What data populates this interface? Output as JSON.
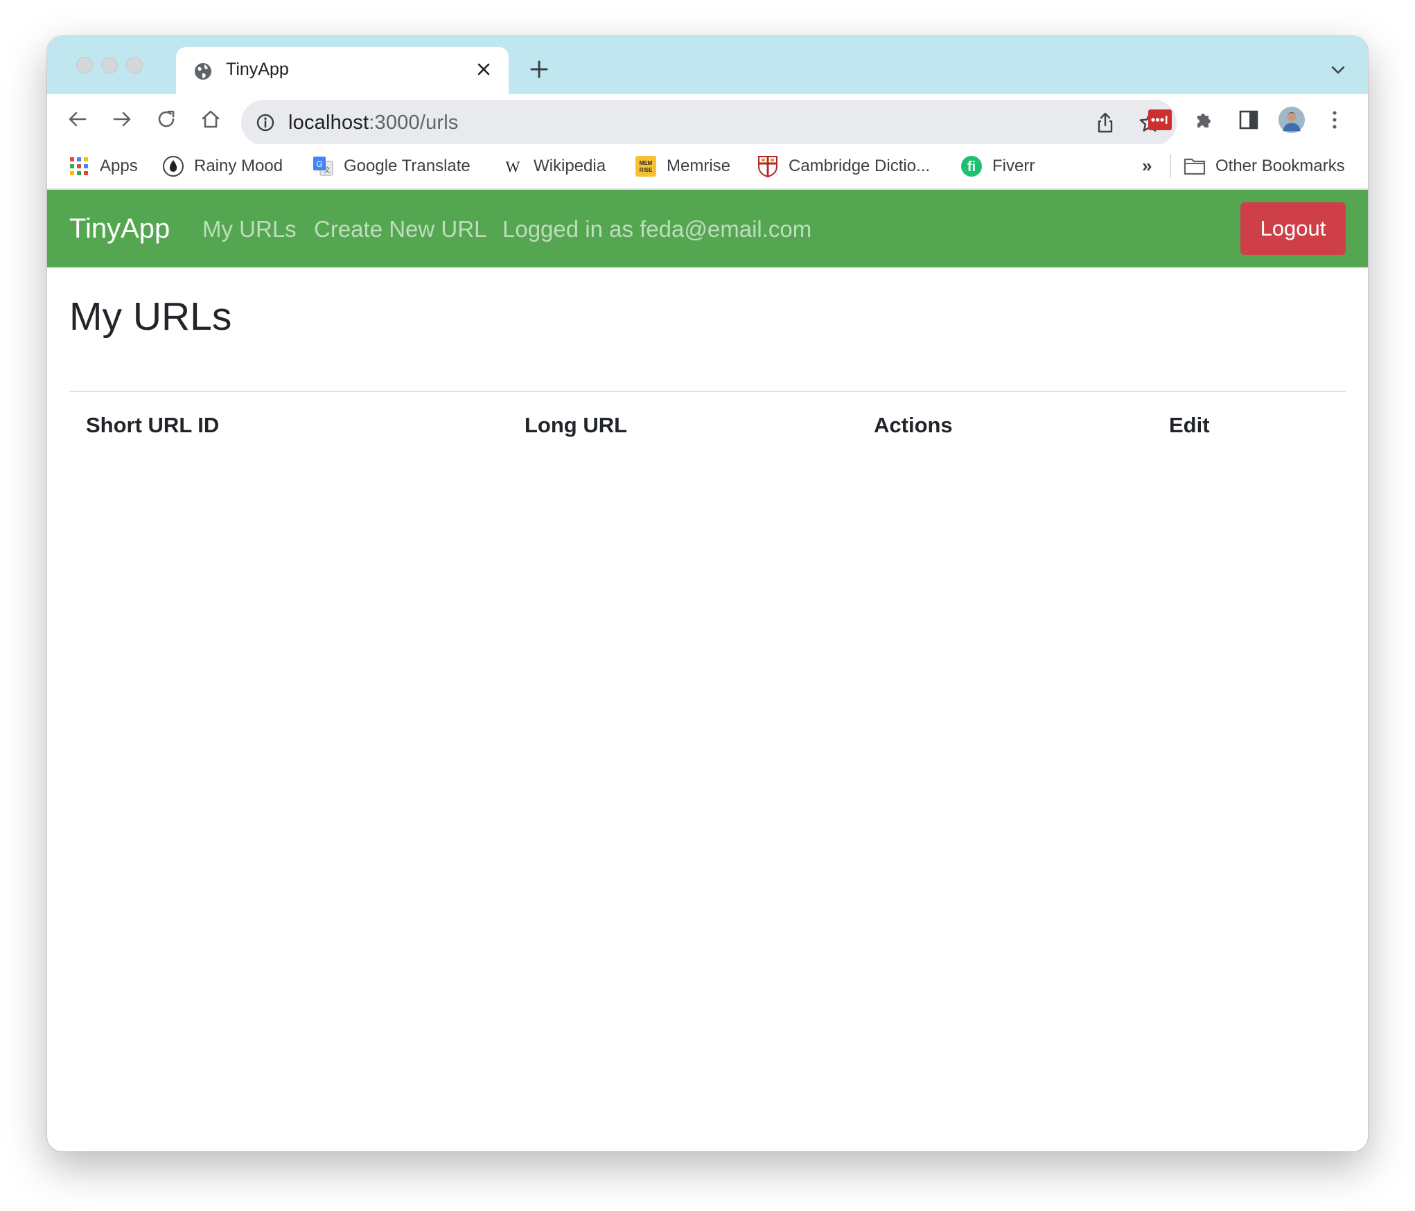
{
  "browser": {
    "tab": {
      "title": "TinyApp"
    },
    "address_bar": {
      "host": "localhost",
      "path": ":3000/urls"
    },
    "bookmarks": [
      {
        "label": "Apps",
        "icon": "apps-grid-icon"
      },
      {
        "label": "Rainy Mood",
        "icon": "rainy-mood-icon"
      },
      {
        "label": "Google Translate",
        "icon": "google-translate-icon"
      },
      {
        "label": "Wikipedia",
        "icon": "wikipedia-icon"
      },
      {
        "label": "Memrise",
        "icon": "memrise-icon"
      },
      {
        "label": "Cambridge Dictio...",
        "icon": "cambridge-icon"
      },
      {
        "label": "Fiverr",
        "icon": "fiverr-icon"
      }
    ],
    "bookmarks_overflow": "»",
    "other_bookmarks": {
      "label": "Other Bookmarks",
      "icon": "folder-icon"
    }
  },
  "app": {
    "brand": "TinyApp",
    "nav": {
      "my_urls": "My URLs",
      "create_new": "Create New URL",
      "logged_in": "Logged in as feda@email.com"
    },
    "logout_label": "Logout",
    "colors": {
      "navbar": "#54a651",
      "logout": "#cf3f48",
      "tabstrip": "#c0e6ef"
    }
  },
  "main": {
    "title": "My URLs",
    "table": {
      "headers": [
        "Short URL ID",
        "Long URL",
        "Actions",
        "Edit"
      ],
      "rows": []
    }
  }
}
